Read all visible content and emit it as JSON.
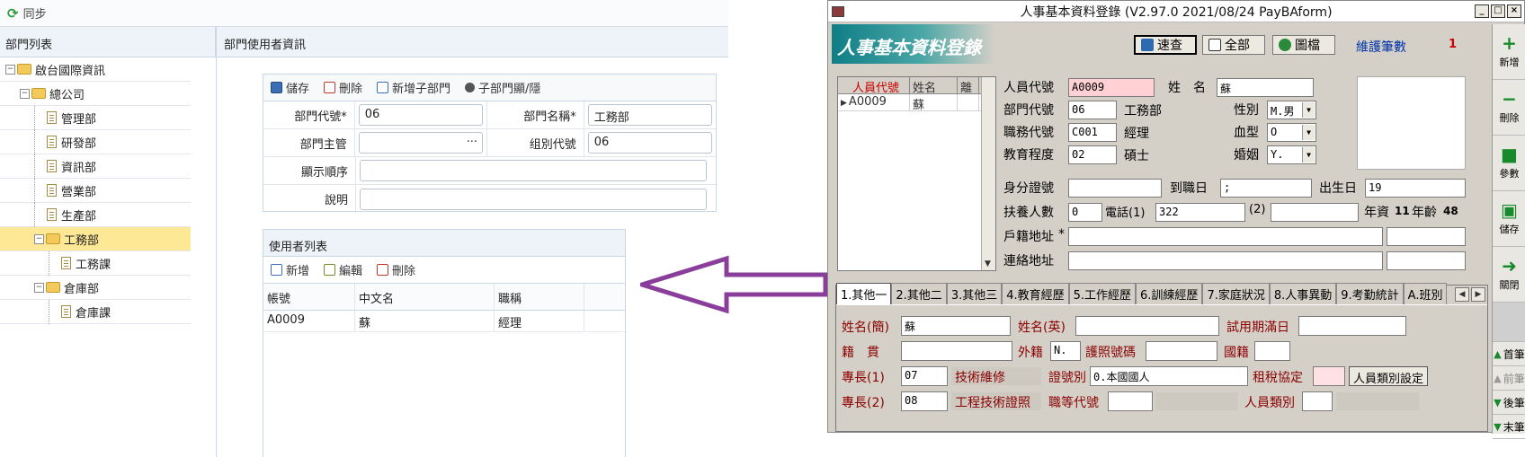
{
  "left": {
    "sync_label": "同步",
    "tree_title": "部門列表",
    "dept_title": "部門使用者資訊",
    "tree": [
      {
        "label": "啟台國際資訊",
        "kind": "folder",
        "toggle": "⊟",
        "depth": 0
      },
      {
        "label": "總公司",
        "kind": "folder",
        "toggle": "⊟",
        "depth": 1
      },
      {
        "label": "管理部",
        "kind": "doc",
        "depth": 2
      },
      {
        "label": "研發部",
        "kind": "doc",
        "depth": 2
      },
      {
        "label": "資訊部",
        "kind": "doc",
        "depth": 2
      },
      {
        "label": "營業部",
        "kind": "doc",
        "depth": 2
      },
      {
        "label": "生產部",
        "kind": "doc",
        "depth": 2
      },
      {
        "label": "工務部",
        "kind": "folder",
        "toggle": "⊟",
        "depth": 2,
        "selected": true
      },
      {
        "label": "工務課",
        "kind": "doc",
        "depth": 3
      },
      {
        "label": "倉庫部",
        "kind": "folder",
        "toggle": "⊟",
        "depth": 2
      },
      {
        "label": "倉庫課",
        "kind": "doc",
        "depth": 3
      }
    ],
    "form_toolbar": {
      "save": "儲存",
      "delete": "刪除",
      "add_child": "新增子部門",
      "toggle_child": "子部門顯/隱"
    },
    "form": {
      "dept_code_label": "部門代號*",
      "dept_code_value": "06",
      "dept_name_label": "部門名稱*",
      "dept_name_value": "工務部",
      "manager_label": "部門主管",
      "manager_value": "",
      "group_code_label": "组別代號",
      "group_code_value": "06",
      "order_label": "顯示順序",
      "order_value": "",
      "desc_label": "說明",
      "desc_value": ""
    },
    "user_list": {
      "title": "使用者列表",
      "add": "新增",
      "edit": "編輯",
      "delete": "刪除",
      "columns": [
        "帳號",
        "中文名",
        "職稱"
      ],
      "rows": [
        [
          "A0009",
          "蘇",
          "經理"
        ]
      ]
    }
  },
  "right": {
    "title": "人事基本資料登錄 (V2.97.0 2021/08/24 PayBAform)",
    "banner": "人事基本資料登錄",
    "search_btn": "速查",
    "all_btn": "全部",
    "archive_btn": "圖檔",
    "maint_label": "維護筆數",
    "maint_count": "1",
    "list_headers": [
      "人員代號",
      "姓名",
      "離"
    ],
    "list_rows": [
      [
        "A0009",
        "蘇",
        ""
      ]
    ],
    "fields": {
      "emp_code_label": "人員代號",
      "emp_code": "A0009",
      "name_label": "姓　名",
      "name": "蘇",
      "dept_label": "部門代號",
      "dept_code": "06",
      "dept_name": "工務部",
      "gender_label": "性別",
      "gender": "M.男",
      "job_label": "職務代號",
      "job_code": "C001",
      "job_name": "經理",
      "blood_label": "血型",
      "blood": "O",
      "edu_label": "教育程度",
      "edu_code": "02",
      "edu_name": "碩士",
      "marriage_label": "婚姻",
      "marriage": "Y.",
      "id_label": "身分證號",
      "id_value": "",
      "join_label": "到職日",
      "join_value": ";",
      "birth_label": "出生日",
      "birth_value": "19",
      "dependents_label": "扶養人數",
      "dependents": "0",
      "phone1_label": "電話(1)",
      "phone1": "322",
      "phone2_label": "(2)",
      "phone2": "",
      "seniority_label": "年資",
      "seniority": "11",
      "age_label": "年齡",
      "age": "48",
      "reg_addr_label": "戶籍地址",
      "reg_addr_mark": "*",
      "contact_addr_label": "連絡地址"
    },
    "tabs": [
      "1.其他一",
      "2.其他二",
      "3.其他三",
      "4.教育經歷",
      "5.工作經歷",
      "6.訓練經歷",
      "7.家庭狀況",
      "8.人事異動",
      "9.考勤統計",
      "A.班別"
    ],
    "tab_body": {
      "short_name_label": "姓名(簡)",
      "short_name": "蘇",
      "eng_name_label": "姓名(英)",
      "eng_name": "",
      "probation_label": "試用期滿日",
      "probation": "",
      "native_label": "籍　貫",
      "native": "",
      "foreign_label": "外籍",
      "foreign": "N.",
      "passport_label": "護照號碼",
      "passport": "",
      "nationality_label": "國籍",
      "nationality": "",
      "skill1_label": "專長(1)",
      "skill1_code": "07",
      "skill1_name": "技術維修",
      "cert_type_label": "證號別",
      "cert_type": "0.本國國人",
      "tax_label": "租稅協定",
      "tax": "",
      "staff_type_btn": "人員類別設定",
      "skill2_label": "專長(2)",
      "skill2_code": "08",
      "skill2_name": "工程技術證照",
      "grade_label": "職等代號",
      "grade": "",
      "staff_cat_label": "人員類別",
      "staff_cat": ""
    },
    "side": {
      "add": "新增",
      "delete": "刪除",
      "params": "參數",
      "save": "儲存",
      "close": "關閉",
      "first": "首筆",
      "prev": "前筆",
      "next": "後筆",
      "last": "末筆"
    }
  },
  "colors": {
    "arrow": "#8a3d9a",
    "selected_row": "#fde895",
    "banner": "#0f7e86"
  }
}
